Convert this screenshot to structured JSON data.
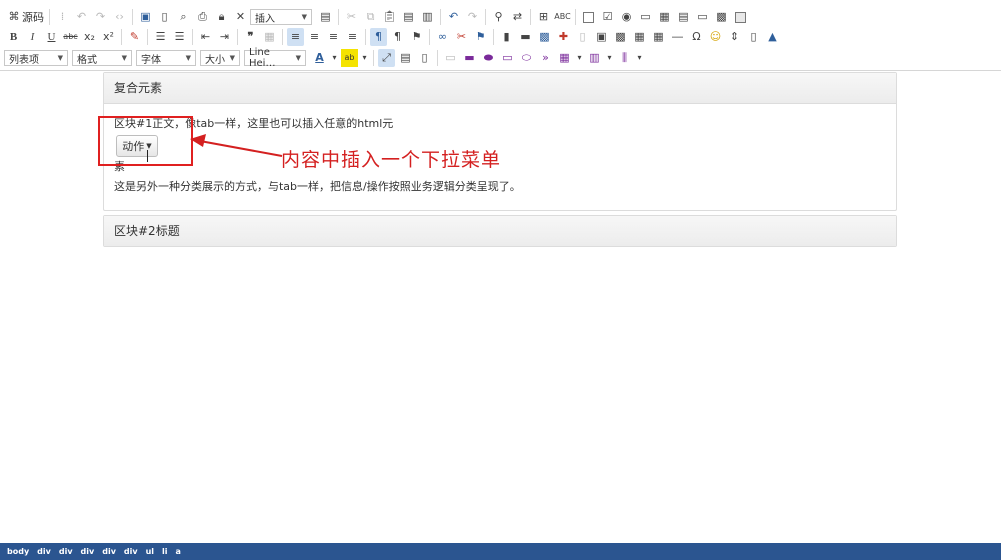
{
  "toolbar": {
    "source_label": "源码",
    "insert_label": "插入",
    "list_item_label": "列表项",
    "format_label": "格式",
    "font_label": "字体",
    "size_label": "大小",
    "line_height_label": "Line Hei…",
    "font_color_glyph": "A",
    "highlight_glyph": "ab",
    "icons": {
      "bold": "B",
      "italic": "I",
      "underline": "U",
      "strike": "abc",
      "subscript": "x₂",
      "superscript": "x²",
      "omega": "Ω",
      "smile": "☺",
      "abc_spell": "ABC"
    }
  },
  "panels": [
    {
      "title": "复合元素",
      "intro": "区块#1正文，像tab一样，这里也可以插入任意的html元",
      "action_label": "动作",
      "orphan_text": "素",
      "description": "这是另外一种分类展示的方式，与tab一样，把信息/操作按照业务逻辑分类呈现了。"
    },
    {
      "title": "区块#2标题"
    }
  ],
  "annotation": {
    "text": "内容中插入一个下拉菜单",
    "color": "#d42020"
  },
  "statusbar": {
    "path": [
      "body",
      "div",
      "div",
      "div",
      "div",
      "div",
      "ul",
      "li",
      "a"
    ]
  },
  "colors": {
    "statusbar_bg": "#2b5590",
    "active_button": "#cfe0f3"
  }
}
